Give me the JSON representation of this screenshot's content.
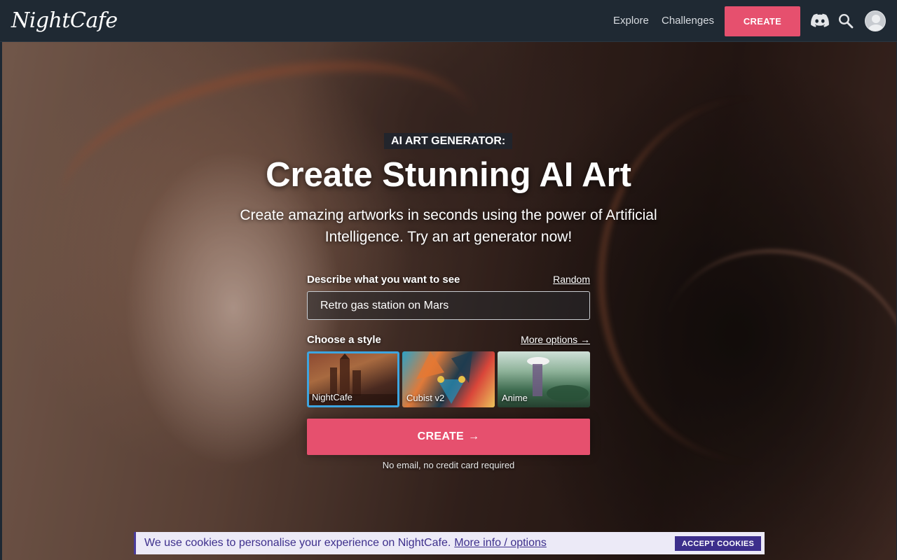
{
  "header": {
    "logo": "NightCafe",
    "nav": {
      "explore": "Explore",
      "challenges": "Challenges"
    },
    "create_label": "CREATE",
    "icons": [
      "discord-icon",
      "search-icon",
      "avatar"
    ]
  },
  "hero": {
    "badge": "AI ART GENERATOR:",
    "title": "Create Stunning AI Art",
    "subtitle": "Create amazing artworks in seconds using the power of Artificial Intelligence. Try an art generator now!"
  },
  "form": {
    "prompt_label": "Describe what you want to see",
    "random_link": "Random",
    "prompt_value": "Retro gas station on Mars",
    "style_label": "Choose a style",
    "more_options": "More options",
    "styles": [
      {
        "name": "NightCafe",
        "selected": true
      },
      {
        "name": "Cubist v2",
        "selected": false
      },
      {
        "name": "Anime",
        "selected": false
      }
    ],
    "create_label": "CREATE",
    "note": "No email, no credit card required"
  },
  "cookie": {
    "text": "We use cookies to personalise your experience on NightCafe.",
    "link": "More info / options",
    "accept": "ACCEPT COOKIES",
    "accent_color": "#3d2f8c"
  },
  "colors": {
    "primary": "#e6506e",
    "header_bg": "#1f2933",
    "selected_border": "#3da5e0"
  }
}
